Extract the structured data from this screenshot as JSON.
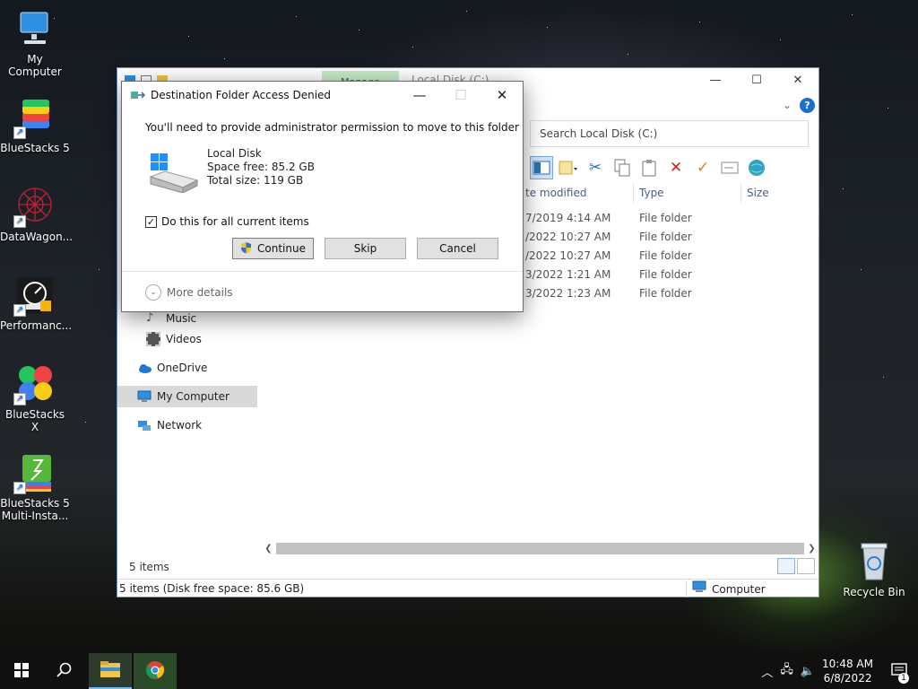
{
  "desktop": {
    "icons": [
      {
        "label": "My Computer",
        "icon": "my-computer-icon"
      },
      {
        "label": "BlueStacks 5",
        "icon": "bluestacks-icon"
      },
      {
        "label": "DataWagon...",
        "icon": "datawagon-icon"
      },
      {
        "label": "Performanc...",
        "icon": "performance-icon"
      },
      {
        "label": "BlueStacks X",
        "icon": "bluestacks-x-icon"
      },
      {
        "label_line1": "BlueStacks 5",
        "label_line2": "Multi-Insta...",
        "icon": "bluestacks-multi-icon"
      },
      {
        "label": "Recycle Bin",
        "icon": "recycle-bin-icon"
      }
    ]
  },
  "explorer": {
    "manage_tab": "Manage",
    "title": "Local Disk (C:)",
    "search_placeholder": "Search Local Disk (C:)",
    "columns": {
      "date": "te modified",
      "type": "Type",
      "size": "Size"
    },
    "rows": [
      {
        "date": "7/2019 4:14 AM",
        "type": "File folder"
      },
      {
        "date": "/2022 10:27 AM",
        "type": "File folder"
      },
      {
        "date": "/2022 10:27 AM",
        "type": "File folder"
      },
      {
        "date": "3/2022 1:21 AM",
        "type": "File folder"
      },
      {
        "date": "3/2022 1:23 AM",
        "type": "File folder"
      }
    ],
    "nav": {
      "music": "Music",
      "videos": "Videos",
      "onedrive": "OneDrive",
      "my_computer": "My Computer",
      "network": "Network"
    },
    "items_count": "5 items",
    "status_left": "5 items (Disk free space: 85.6 GB)",
    "status_right": "Computer"
  },
  "dialog": {
    "title": "Destination Folder Access Denied",
    "message": "You'll need to provide administrator permission to move to this folder",
    "disk_name": "Local Disk",
    "space_free": "Space free: 85.2 GB",
    "total_size": "Total size: 119 GB",
    "checkbox_label": "Do this for all current items",
    "checkbox_checked": true,
    "continue_label": "Continue",
    "skip_label": "Skip",
    "cancel_label": "Cancel",
    "more_details": "More details"
  },
  "taskbar": {
    "time": "10:48 AM",
    "date": "6/8/2022",
    "notification_count": "1"
  }
}
